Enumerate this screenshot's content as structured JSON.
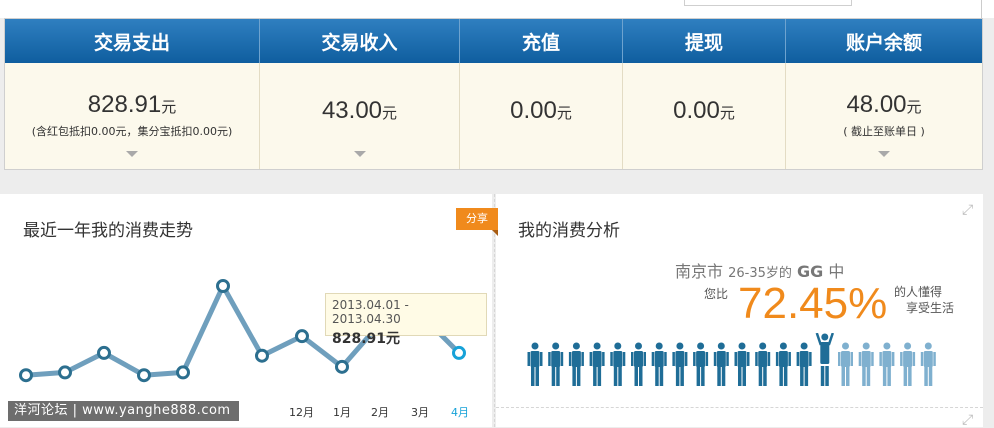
{
  "summary": {
    "columns": [
      {
        "header": "交易支出",
        "amount": "828.91",
        "unit": "元",
        "note": "(含红包抵扣0.00元，集分宝抵扣0.00元)"
      },
      {
        "header": "交易收入",
        "amount": "43.00",
        "unit": "元",
        "note": ""
      },
      {
        "header": "充值",
        "amount": "0.00",
        "unit": "元",
        "note": ""
      },
      {
        "header": "提现",
        "amount": "0.00",
        "unit": "元",
        "note": ""
      },
      {
        "header": "账户余额",
        "amount": "48.00",
        "unit": "元",
        "note": "( 截止至账单日 )"
      }
    ]
  },
  "trend": {
    "title": "最近一年我的消费走势",
    "share_label": "分享",
    "tooltip": {
      "range": "2013.04.01 - 2013.04.30",
      "amount": "828.91元"
    },
    "months_visible": [
      "12月",
      "1月",
      "2月",
      "3月",
      "4月"
    ]
  },
  "chart_data": {
    "type": "line",
    "title": "最近一年我的消费走势",
    "categories": [
      "",
      "",
      "",
      "",
      "",
      "",
      "",
      "",
      "",
      "12月",
      "1月",
      "2月",
      "3月",
      "4月"
    ],
    "series": [
      {
        "values": [
          1,
          2,
          9,
          1,
          2,
          33,
          8,
          15,
          4,
          20,
          23,
          10,
          9
        ]
      }
    ],
    "highlight": {
      "label": "2013.04.01 - 2013.04.30",
      "value": "828.91元"
    },
    "color": "#6f9fbd"
  },
  "analysis": {
    "title": "我的消费分析",
    "city": "南京市",
    "age_range": "26-35岁的",
    "group": "GG",
    "group_suffix": "中",
    "compare_prefix": "您比",
    "percent": "72.45%",
    "tail_line1": "的人懂得",
    "tail_line2": "享受生活",
    "people_total": 20,
    "people_dark": 14,
    "highlight_index": 14
  },
  "watermark": "洋河论坛 | www.yanghe888.com",
  "colors": {
    "header_blue": "#1565a8",
    "accent_orange": "#f08a1c",
    "line": "#6f9fbd",
    "active_month": "#17a2d8"
  }
}
